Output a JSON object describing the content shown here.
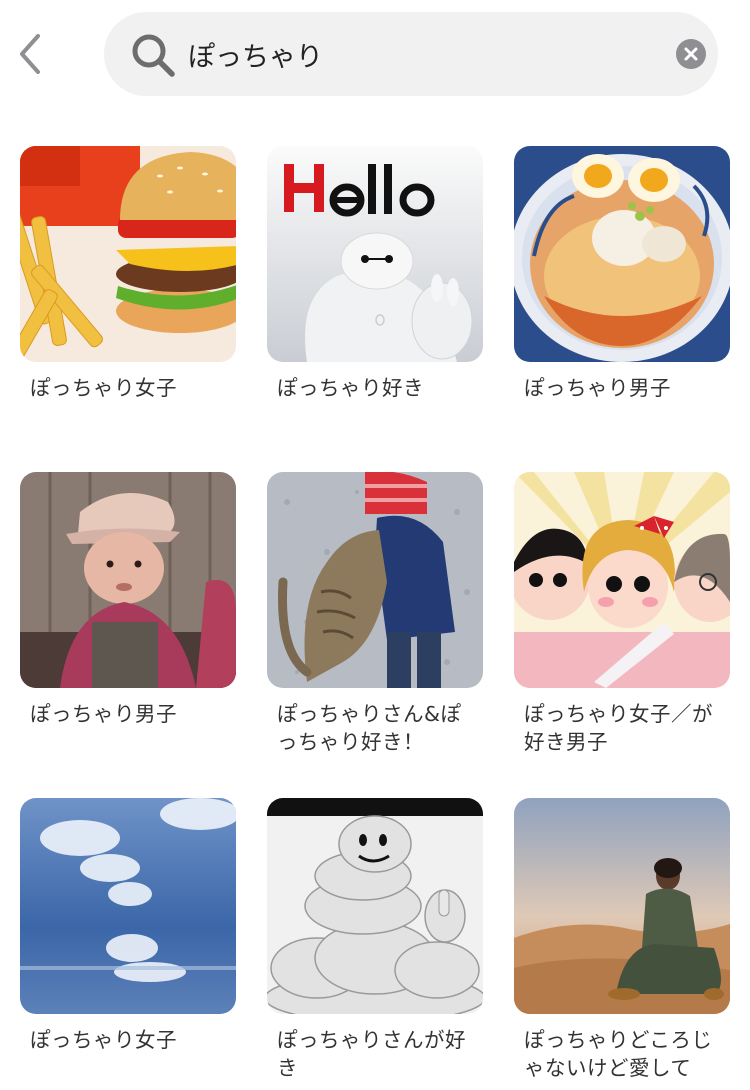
{
  "header": {
    "back_icon": "chevron-left-icon",
    "search": {
      "icon": "search-icon",
      "value": "ぽっちゃり",
      "clear_icon": "clear-icon"
    }
  },
  "colors": {
    "search_bg": "#f1f1f1",
    "label_text": "#333333",
    "clear_button": "#8e8e93",
    "back_arrow": "#8e8e93"
  },
  "results": [
    {
      "label": "ぽっちゃり女子",
      "image": "hamburger-and-fries"
    },
    {
      "label": "ぽっちゃり好き",
      "image": "hello-white-robot"
    },
    {
      "label": "ぽっちゃり男子",
      "image": "ramen-bowl"
    },
    {
      "label": "ぽっちゃり男子",
      "image": "baby-in-cap-photo"
    },
    {
      "label": "ぽっちゃりさん&ぽっちゃり好き！",
      "image": "cat-hugging-child"
    },
    {
      "label": "ぽっちゃり女子／が好き男子",
      "image": "cartoon-girls"
    },
    {
      "label": "ぽっちゃり女子",
      "image": "blue-sky-clouds"
    },
    {
      "label": "ぽっちゃりさんが好き",
      "image": "tire-mascot"
    },
    {
      "label": "ぽっちゃりどころじゃないけど愛して",
      "image": "woman-in-desert"
    }
  ]
}
